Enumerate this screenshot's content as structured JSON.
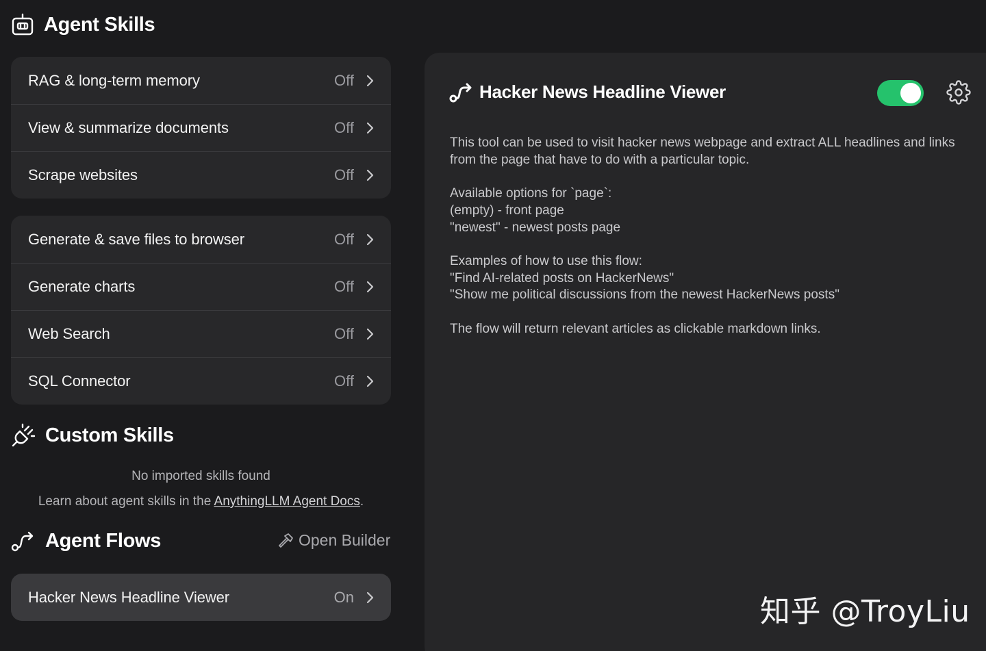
{
  "header": {
    "title": "Agent Skills",
    "icon": "robot-icon"
  },
  "skills_group_1": [
    {
      "label": "RAG & long-term memory",
      "status": "Off"
    },
    {
      "label": "View & summarize documents",
      "status": "Off"
    },
    {
      "label": "Scrape websites",
      "status": "Off"
    }
  ],
  "skills_group_2": [
    {
      "label": "Generate & save files to browser",
      "status": "Off"
    },
    {
      "label": "Generate charts",
      "status": "Off"
    },
    {
      "label": "Web Search",
      "status": "Off"
    },
    {
      "label": "SQL Connector",
      "status": "Off"
    }
  ],
  "custom_skills": {
    "title": "Custom Skills",
    "icon": "plug-icon",
    "empty_text": "No imported skills found",
    "learn_prefix": "Learn about agent skills in the ",
    "learn_link": "AnythingLLM Agent Docs",
    "learn_suffix": "."
  },
  "agent_flows": {
    "title": "Agent Flows",
    "icon": "flow-icon",
    "open_builder": "Open Builder",
    "items": [
      {
        "label": "Hacker News Headline Viewer",
        "status": "On"
      }
    ]
  },
  "detail": {
    "title": "Hacker News Headline Viewer",
    "enabled": true,
    "toggle_color": "#25c26c",
    "paragraphs": [
      [
        "This tool can be used to visit hacker news webpage and extract ALL headlines and links from the page that have to do with a particular topic."
      ],
      [
        "Available options for `page`:",
        "(empty) - front page",
        "\"newest\" - newest posts page"
      ],
      [
        "Examples of how to use this flow:",
        "\"Find AI-related posts on HackerNews\"",
        "\"Show me political discussions from the newest HackerNews posts\""
      ],
      [
        "The flow will return relevant articles as clickable markdown links."
      ]
    ]
  },
  "watermark": "知乎 @TroyLiu"
}
